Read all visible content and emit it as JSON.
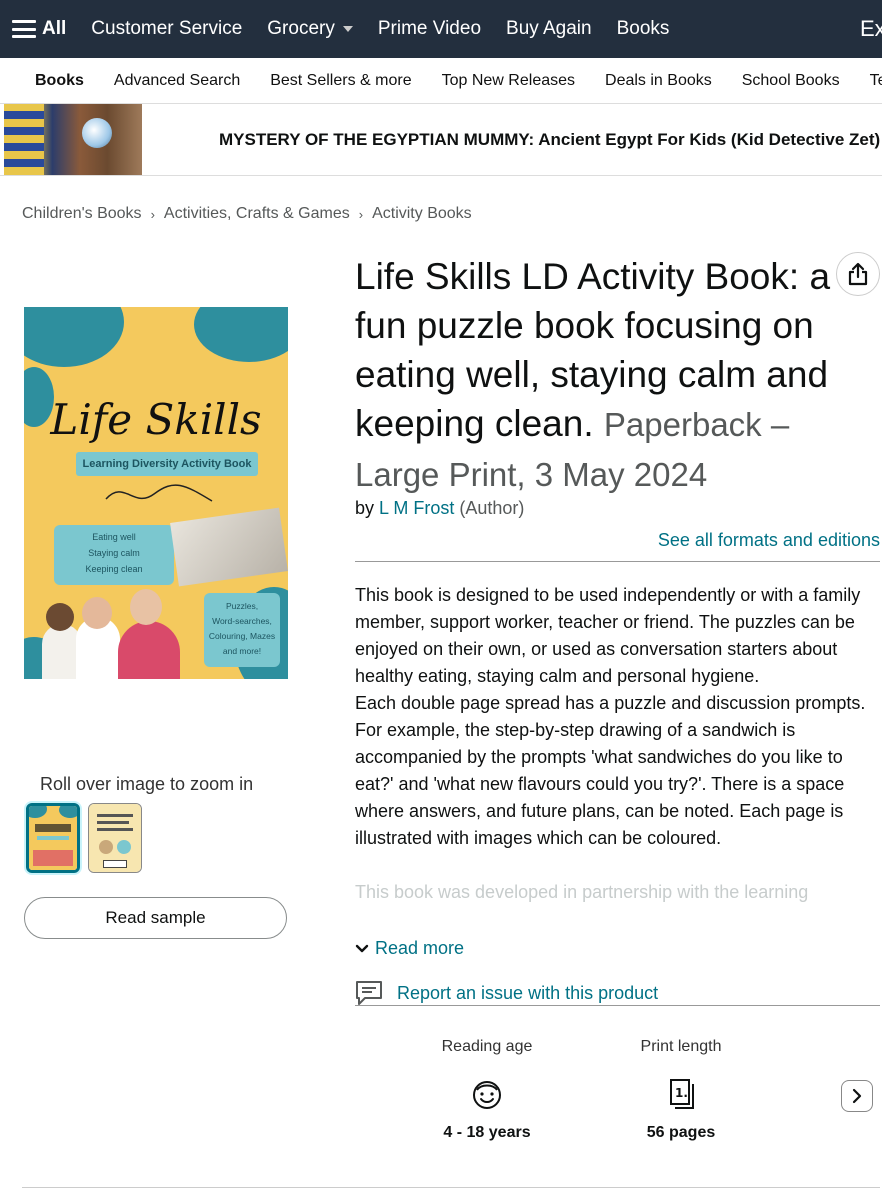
{
  "topnav": {
    "all_label": "All",
    "items": [
      "Customer Service",
      "Grocery",
      "Prime Video",
      "Buy Again",
      "Books"
    ],
    "cut_text": "Ex"
  },
  "subnav": {
    "items": [
      "Books",
      "Advanced Search",
      "Best Sellers & more",
      "Top New Releases",
      "Deals in Books",
      "School Books",
      "Te"
    ]
  },
  "banner": {
    "title": "MYSTERY OF THE EGYPTIAN MUMMY: Ancient Egypt For Kids (Kid Detective Zet)"
  },
  "breadcrumb": {
    "items": [
      "Children's Books",
      "Activities, Crafts & Games",
      "Activity Books"
    ]
  },
  "cover": {
    "title": "Life Skills",
    "subtitle": "Learning Diversity Activity Book",
    "list": [
      "Eating well",
      "Staying calm",
      "Keeping clean"
    ],
    "puzzles": [
      "Puzzles,",
      "Word-searches,",
      "Colouring, Mazes",
      "and more!"
    ]
  },
  "gallery": {
    "zoom_hint": "Roll over image to zoom in",
    "read_sample": "Read sample"
  },
  "product": {
    "title": "Life Skills LD Activity Book: a fun puzzle book focusing on eating well, staying calm and keeping clean.",
    "format": "Paperback – Large Print, 3 May 2024",
    "by": "by",
    "author": "L M Frost",
    "author_role": "(Author)",
    "see_formats": "See all formats and editions",
    "description": [
      "This book is designed to be used independently or with a family member, support worker, teacher or friend. The puzzles can be enjoyed on their own, or used as conversation starters about healthy eating, staying calm and personal hygiene.",
      "Each double page spread has a puzzle and discussion prompts. For example, the step-by-step drawing of a sandwich is accompanied by the prompts 'what sandwiches do you like to eat?' and 'what new flavours could you try?'. There is a space where answers, and future plans, can be noted. Each page is illustrated with images which can be coloured.",
      "This book was developed in partnership with the learning"
    ],
    "read_more": "Read more",
    "report": "Report an issue with this product"
  },
  "attributes": [
    {
      "label": "Reading age",
      "value": "4 - 18 years",
      "icon": "face-icon"
    },
    {
      "label": "Print length",
      "value": "56 pages",
      "icon": "book-pages-icon"
    }
  ],
  "colors": {
    "nav_bg": "#232f3e",
    "link": "#007185",
    "cover_yellow": "#f4c95d",
    "cover_teal": "#2e8f9e"
  }
}
